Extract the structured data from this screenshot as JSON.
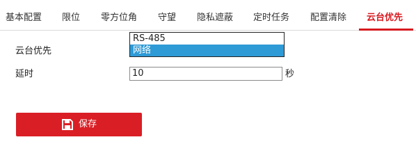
{
  "tabs": [
    {
      "label": "基本配置"
    },
    {
      "label": "限位"
    },
    {
      "label": "零方位角"
    },
    {
      "label": "守望"
    },
    {
      "label": "隐私遮蔽"
    },
    {
      "label": "定时任务"
    },
    {
      "label": "配置清除"
    },
    {
      "label": "云台优先"
    }
  ],
  "active_tab": "云台优先",
  "form": {
    "priority_label": "云台优先",
    "priority_options": [
      "RS-485",
      "网络"
    ],
    "priority_highlighted": "网络",
    "delay_label": "延时",
    "delay_value": "10",
    "delay_unit": "秒"
  },
  "save_button": {
    "label": "保存",
    "icon": "floppy-disk-icon"
  },
  "colors": {
    "accent": "#d7191f",
    "button": "#da1e25",
    "selection": "#2e9ad6",
    "divider": "#d9d9d9"
  }
}
